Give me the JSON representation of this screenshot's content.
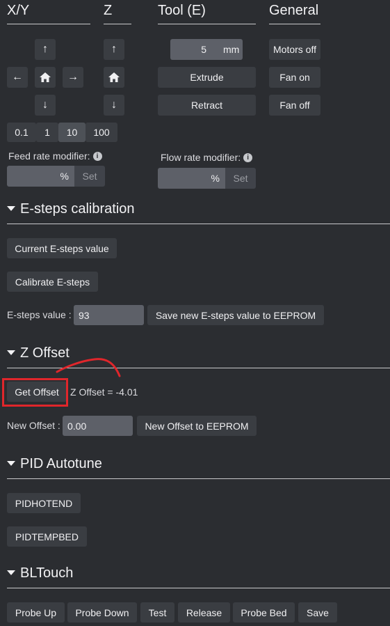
{
  "columns": {
    "xy": "X/Y",
    "z": "Z",
    "tool": "Tool (E)",
    "general": "General"
  },
  "xy_controls": {
    "up_icon": "arrow-up-icon",
    "left_icon": "arrow-left-icon",
    "home_icon": "home-icon",
    "right_icon": "arrow-right-icon",
    "down_icon": "arrow-down-icon"
  },
  "z_controls": {
    "up_icon": "arrow-up-icon",
    "home_icon": "home-icon",
    "down_icon": "arrow-down-icon"
  },
  "step_sizes": [
    "0.1",
    "1",
    "10",
    "100"
  ],
  "selected_step": "10",
  "tool": {
    "amount_value": "5",
    "amount_unit": "mm",
    "extrude_label": "Extrude",
    "retract_label": "Retract"
  },
  "general": {
    "motors_off": "Motors off",
    "fan_on": "Fan on",
    "fan_off": "Fan off"
  },
  "feed_rate": {
    "label": "Feed rate modifier:",
    "value": "",
    "unit": "%",
    "set_label": "Set"
  },
  "flow_rate": {
    "label": "Flow rate modifier:",
    "value": "",
    "unit": "%",
    "set_label": "Set"
  },
  "esteps": {
    "title": "E-steps calibration",
    "current_label": "Current E-steps value",
    "calibrate_label": "Calibrate E-steps",
    "value_label": "E-steps value :",
    "value": "93",
    "save_label": "Save new E-steps value to EEPROM"
  },
  "zoffset": {
    "title": "Z Offset",
    "get_label": "Get Offset",
    "readout": "Z Offset = -4.01",
    "new_label": "New Offset :",
    "new_value": "0.00",
    "save_label": "New Offset to EEPROM",
    "annotation_color": "#e0262b"
  },
  "pid": {
    "title": "PID Autotune",
    "hotend_label": "PIDHOTEND",
    "bed_label": "PIDTEMPBED"
  },
  "bltouch": {
    "title": "BLTouch",
    "buttons": [
      "Probe Up",
      "Probe Down",
      "Test",
      "Release",
      "Probe Bed",
      "Save"
    ]
  },
  "icon_glyphs": {
    "up": "↑",
    "down": "↓",
    "left": "←",
    "right": "→"
  }
}
